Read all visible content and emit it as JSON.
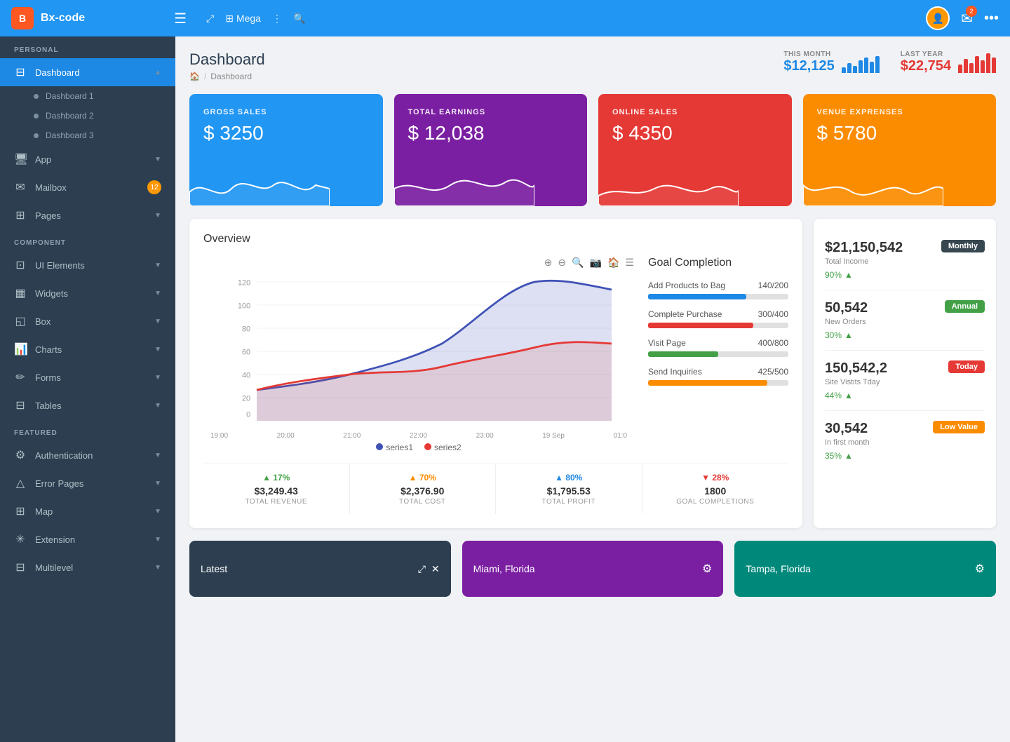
{
  "brand": {
    "logo_text": "B",
    "name": "Bx-code"
  },
  "header": {
    "nav_items": [
      "Mega",
      "⋮"
    ],
    "search_placeholder": "Search...",
    "mail_badge": "2",
    "avatar_text": "U"
  },
  "sidebar": {
    "personal_label": "PERSONAL",
    "dashboard_label": "Dashboard",
    "dashboard_subs": [
      "Dashboard 1",
      "Dashboard 2",
      "Dashboard 3"
    ],
    "app_label": "App",
    "mailbox_label": "Mailbox",
    "mailbox_badge": "12",
    "pages_label": "Pages",
    "component_label": "COMPONENT",
    "ui_elements_label": "UI Elements",
    "widgets_label": "Widgets",
    "box_label": "Box",
    "charts_label": "Charts",
    "forms_label": "Forms",
    "tables_label": "Tables",
    "featured_label": "FEATURED",
    "authentication_label": "Authentication",
    "error_pages_label": "Error Pages",
    "map_label": "Map",
    "extension_label": "Extension",
    "multilevel_label": "Multilevel"
  },
  "page": {
    "title": "Dashboard",
    "breadcrumb_home": "🏠",
    "breadcrumb_sep": "/",
    "breadcrumb_current": "Dashboard"
  },
  "header_stats": {
    "this_month_label": "THIS MONTH",
    "this_month_value": "$12,125",
    "last_year_label": "LAST YEAR",
    "last_year_value": "$22,754",
    "bars_this_month": [
      8,
      14,
      10,
      18,
      22,
      16,
      24
    ],
    "bars_last_year": [
      12,
      20,
      14,
      24,
      18,
      28,
      22
    ]
  },
  "stat_cards": [
    {
      "label": "GROSS SALES",
      "value": "$ 3250",
      "color": "blue"
    },
    {
      "label": "TOTAL EARNINGS",
      "value": "$ 12,038",
      "color": "purple"
    },
    {
      "label": "ONLINE SALES",
      "value": "$ 4350",
      "color": "red"
    },
    {
      "label": "VENUE EXPRENSES",
      "value": "$ 5780",
      "color": "orange"
    }
  ],
  "overview": {
    "title": "Overview",
    "chart_toolbar": [
      "⊕",
      "⊖",
      "🔍",
      "📷",
      "🏠",
      "☰"
    ],
    "axis_labels": [
      "19:00",
      "20:00",
      "21:00",
      "22:00",
      "23:00",
      "19 Sep",
      "01:0"
    ],
    "y_labels": [
      "0",
      "20",
      "40",
      "60",
      "80",
      "100",
      "120"
    ],
    "legend": [
      {
        "name": "series1",
        "color": "#3f51b5"
      },
      {
        "name": "series2",
        "color": "#e53935"
      }
    ],
    "bottom_stats": [
      {
        "percent": "▲ 17%",
        "amount": "$3,249.43",
        "label": "TOTAL REVENUE",
        "color": "green"
      },
      {
        "percent": "▲ 70%",
        "amount": "$2,376.90",
        "label": "TOTAL COST",
        "color": "orange-c"
      },
      {
        "percent": "▲ 80%",
        "amount": "$1,795.53",
        "label": "TOTAL PROFIT",
        "color": "blue-c"
      },
      {
        "percent": "▼ 28%",
        "amount": "1800",
        "label": "GOAL COMPLETIONS",
        "color": "red-c"
      }
    ]
  },
  "goals": {
    "title": "Goal Completion",
    "items": [
      {
        "name": "Add Products to Bag",
        "current": 140,
        "total": 200,
        "color": "#1e88e5",
        "pct": 70
      },
      {
        "name": "Complete Purchase",
        "current": 300,
        "total": 400,
        "color": "#e53935",
        "pct": 75
      },
      {
        "name": "Visit Page",
        "current": 400,
        "total": 800,
        "color": "#43a047",
        "pct": 50
      },
      {
        "name": "Send Inquiries",
        "current": 425,
        "total": 500,
        "color": "#fb8c00",
        "pct": 85
      }
    ]
  },
  "right_panel": {
    "stats": [
      {
        "value": "$21,150,542",
        "label": "Total Income",
        "badge": "Monthly",
        "badge_type": "dark",
        "percent": "90%",
        "up": true
      },
      {
        "value": "50,542",
        "label": "New Orders",
        "badge": "Annual",
        "badge_type": "green",
        "percent": "30%",
        "up": true
      },
      {
        "value": "150,542,2",
        "label": "Site Vistits Tday",
        "badge": "Today",
        "badge_type": "red",
        "percent": "44%",
        "up": true
      },
      {
        "value": "30,542",
        "label": "In first month",
        "badge": "Low Value",
        "badge_type": "orange",
        "percent": "35%",
        "up": true
      }
    ]
  },
  "bottom_cards": [
    {
      "label": "Latest",
      "type": "dark"
    },
    {
      "label": "Miami, Florida",
      "type": "miami"
    },
    {
      "label": "Tampa, Florida",
      "type": "tampa"
    }
  ]
}
